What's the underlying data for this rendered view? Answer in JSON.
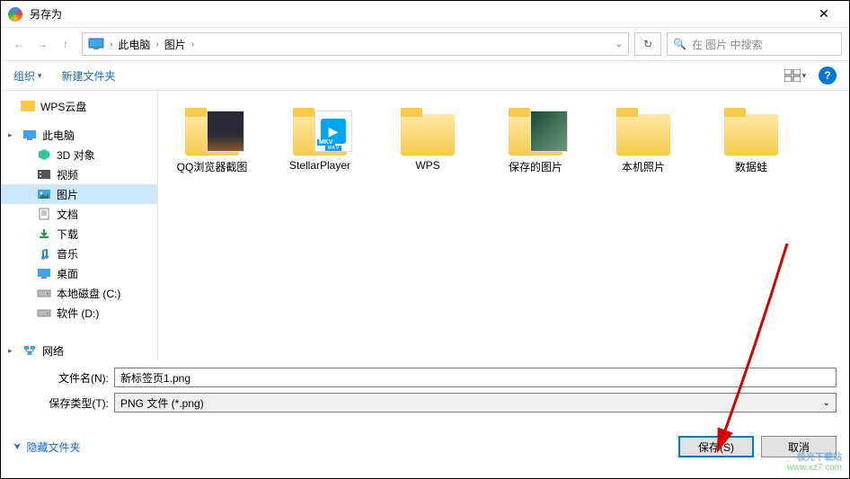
{
  "window": {
    "title": "另存为"
  },
  "nav": {
    "crumb1": "此电脑",
    "crumb2": "图片",
    "search_placeholder": "在 图片 中搜索"
  },
  "toolbar": {
    "organize": "组织",
    "new_folder": "新建文件夹",
    "help": "?"
  },
  "tree": {
    "items": [
      {
        "label": "WPS云盘",
        "icon": "wps",
        "level": 1
      },
      {
        "label": "此电脑",
        "icon": "pc",
        "level": 1,
        "exp": true
      },
      {
        "label": "3D 对象",
        "icon": "3d",
        "level": 2
      },
      {
        "label": "视频",
        "icon": "video",
        "level": 2
      },
      {
        "label": "图片",
        "icon": "pic",
        "level": 2,
        "sel": true
      },
      {
        "label": "文档",
        "icon": "doc",
        "level": 2
      },
      {
        "label": "下载",
        "icon": "dl",
        "level": 2
      },
      {
        "label": "音乐",
        "icon": "music",
        "level": 2
      },
      {
        "label": "桌面",
        "icon": "desk",
        "level": 2
      },
      {
        "label": "本地磁盘 (C:)",
        "icon": "drive",
        "level": 2
      },
      {
        "label": "软件 (D:)",
        "icon": "drive",
        "level": 2
      },
      {
        "label": "网络",
        "icon": "net",
        "level": 1,
        "exp": true
      }
    ]
  },
  "folders": [
    {
      "label": "QQ浏览器截图",
      "preview": "a"
    },
    {
      "label": "StellarPlayer",
      "preview": "b"
    },
    {
      "label": "WPS",
      "preview": ""
    },
    {
      "label": "保存的图片",
      "preview": "c"
    },
    {
      "label": "本机照片",
      "preview": ""
    },
    {
      "label": "数据蛙",
      "preview": ""
    }
  ],
  "fields": {
    "filename_label": "文件名(N):",
    "filename_value": "新标签页1.png",
    "type_label": "保存类型(T):",
    "type_value": "PNG 文件 (*.png)"
  },
  "footer": {
    "hide": "隐藏文件夹",
    "save": "保存(S)",
    "cancel": "取消"
  },
  "watermark": {
    "cn": "极光下载站",
    "url": "www.xz7.com"
  }
}
